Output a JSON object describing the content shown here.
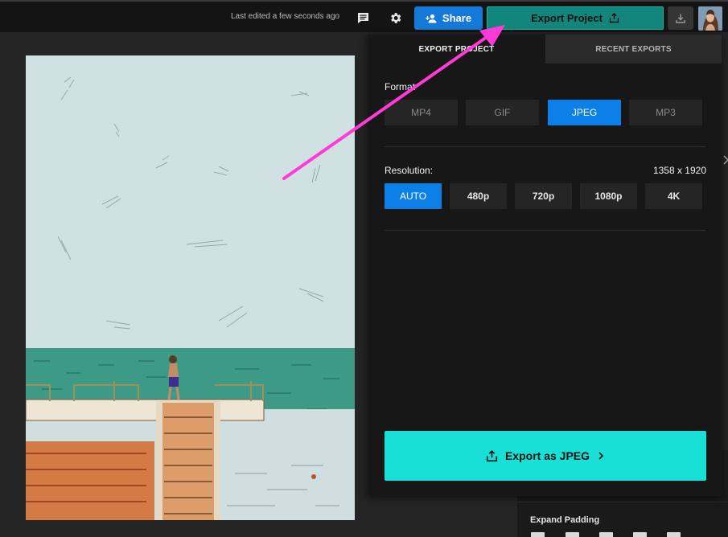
{
  "topbar": {
    "last_edited": "Last edited a few seconds ago",
    "share_label": "Share",
    "export_label": "Export Project"
  },
  "popup": {
    "tabs": [
      {
        "label": "EXPORT PROJECT",
        "active": true
      },
      {
        "label": "RECENT EXPORTS",
        "active": false
      }
    ],
    "format_label": "Format",
    "formats": [
      {
        "label": "MP4",
        "selected": false
      },
      {
        "label": "GIF",
        "selected": false
      },
      {
        "label": "JPEG",
        "selected": true
      },
      {
        "label": "MP3",
        "selected": false
      }
    ],
    "resolution_label": "Resolution:",
    "resolution_value": "1358 x 1920",
    "resolutions": [
      {
        "label": "AUTO",
        "selected": true
      },
      {
        "label": "480p",
        "selected": false
      },
      {
        "label": "720p",
        "selected": false
      },
      {
        "label": "1080p",
        "selected": false
      },
      {
        "label": "4K",
        "selected": false
      }
    ],
    "export_button_label": "Export as JPEG"
  },
  "side_panel": {
    "expand_padding_label": "Expand Padding"
  },
  "colors": {
    "accent_blue": "#0c80e6",
    "export_teal": "#12867a",
    "export_cta": "#19e0d6",
    "annotation_arrow": "#ff3ad8"
  },
  "icons": {
    "comment": "comment-icon",
    "settings": "gear-icon",
    "share": "add-person-icon",
    "export": "upload-icon",
    "download": "download-icon",
    "chevron": "chevron-right-icon"
  }
}
